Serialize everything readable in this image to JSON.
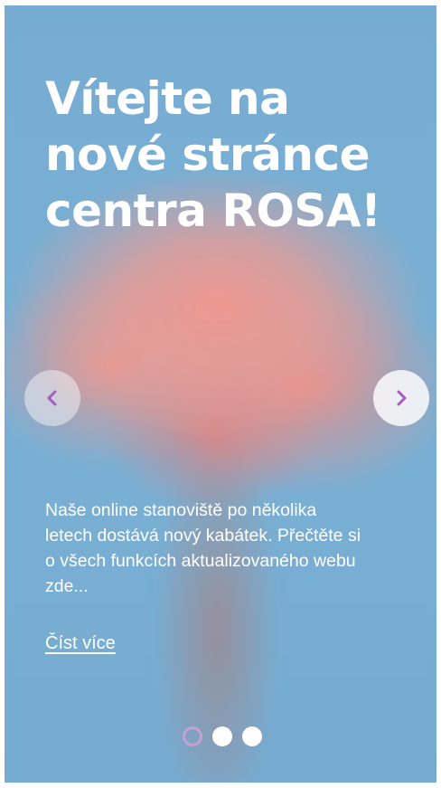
{
  "slider": {
    "title_line1": "Vítejte na",
    "title_line2": "nové stránce",
    "title_line3": "centra ROSA!",
    "description_line1": "Naše online stanoviště po několika",
    "description_line2": "letech dostává nový kabátek. Přečtěte si",
    "description_line3": "o všech funkcích aktualizovaného webu",
    "description_line4": "zde...",
    "read_more_label": "Číst více",
    "prev_icon": "chevron-left-icon",
    "next_icon": "chevron-right-icon",
    "slide_count": 3,
    "active_slide": 1
  },
  "colors": {
    "background_blue": "#79aed3",
    "accent_purple": "#a45cc0",
    "text": "#ffffff"
  }
}
